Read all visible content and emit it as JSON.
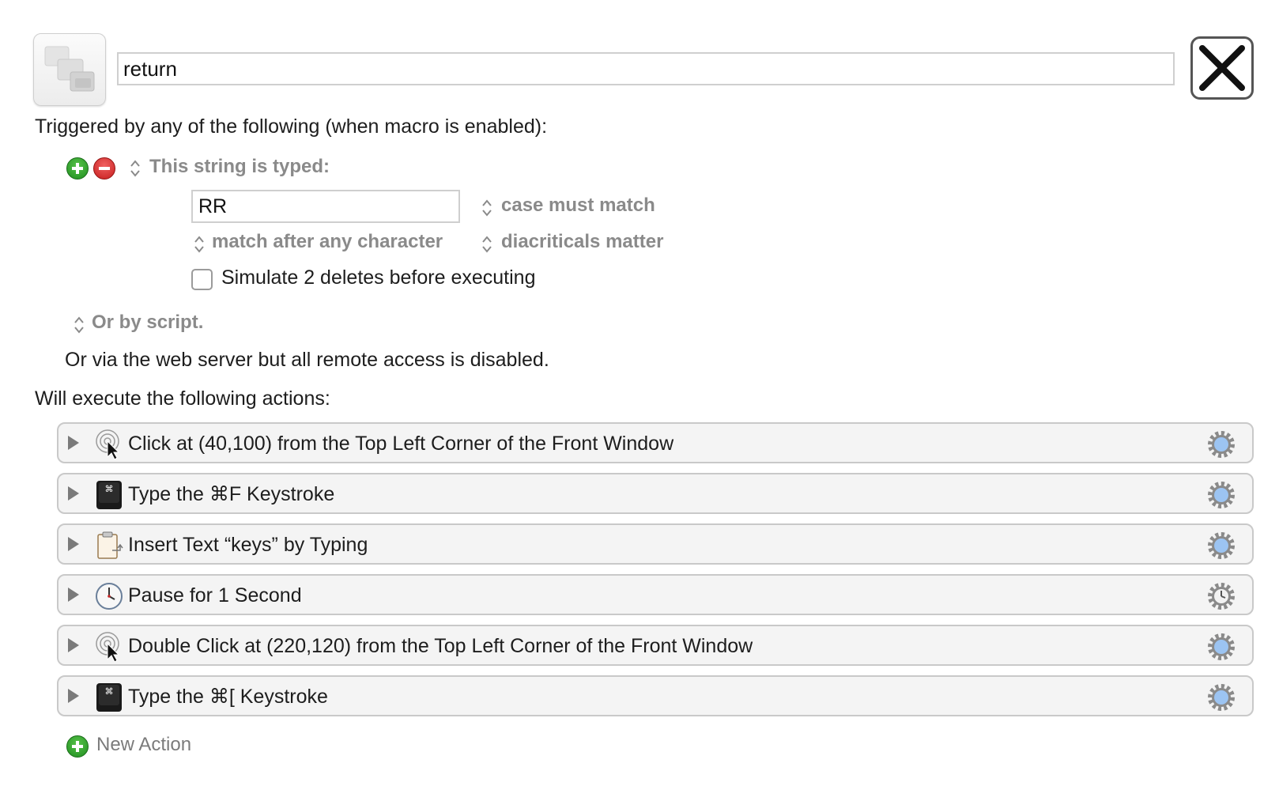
{
  "header": {
    "macro_name": "return"
  },
  "triggers": {
    "heading": "Triggered by any of the following (when macro is enabled):",
    "type_label": "This string is typed:",
    "typed_string": "RR",
    "case_option": "case must match",
    "match_option": "match after any character",
    "diacriticals_option": "diacriticals matter",
    "simulate_label": "Simulate 2 deletes before executing",
    "simulate_checked": false,
    "script_label": "Or by script.",
    "web_server_text": "Or via the web server but all remote access is disabled."
  },
  "actions": {
    "heading": "Will execute the following actions:",
    "items": [
      {
        "label": "Click at (40,100) from the Top Left Corner of the Front Window",
        "icon": "click-icon"
      },
      {
        "label": "Type the ⌘F Keystroke",
        "icon": "keystroke-icon"
      },
      {
        "label": "Insert Text “keys” by Typing",
        "icon": "insert-text-icon"
      },
      {
        "label": "Pause for 1 Second",
        "icon": "clock-icon"
      },
      {
        "label": "Double Click at (220,120) from the Top Left Corner of the Front Window",
        "icon": "click-icon"
      },
      {
        "label": "Type the ⌘[ Keystroke",
        "icon": "keystroke-icon"
      }
    ],
    "new_action_label": "New Action"
  },
  "colors": {
    "add_green": "#2e9e2e",
    "remove_red": "#d92b2b",
    "gear_blue": "#9cc4f2"
  }
}
